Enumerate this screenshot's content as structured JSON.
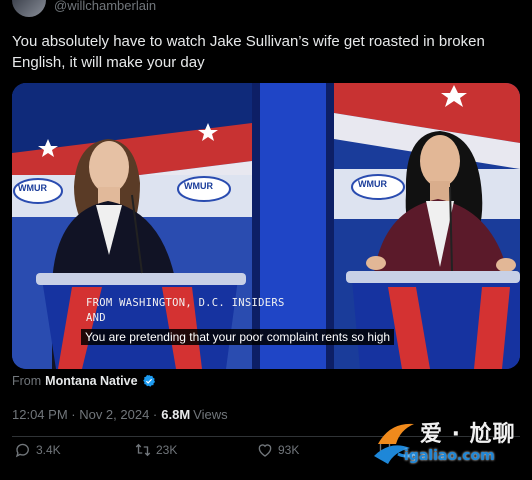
{
  "post": {
    "handle": "@willchamberlain",
    "text": "You absolutely have to watch Jake Sullivan’s wife get roasted in broken English, it will make your day",
    "source_prefix": "From",
    "source_name": "Montana Native",
    "time": "12:04 PM · Nov 2, 2024 ·",
    "views_count": "6.8M",
    "views_label": "Views"
  },
  "video": {
    "chyron_line1": "FROM WASHINGTON, D.C. INSIDERS",
    "chyron_line2": "AND",
    "subtitle": "You are pretending that your poor complaint rents so high",
    "logo_text": "WMUR"
  },
  "actions": {
    "replies": "3.4K",
    "reposts": "23K",
    "likes": "93K"
  },
  "watermark": {
    "line1": "爱 · 尬聊",
    "line2": "igaliao.com"
  },
  "colors": {
    "background": "#000000",
    "text_primary": "#e7e9ea",
    "text_secondary": "#71767b",
    "verified": "#1d9bf0"
  }
}
